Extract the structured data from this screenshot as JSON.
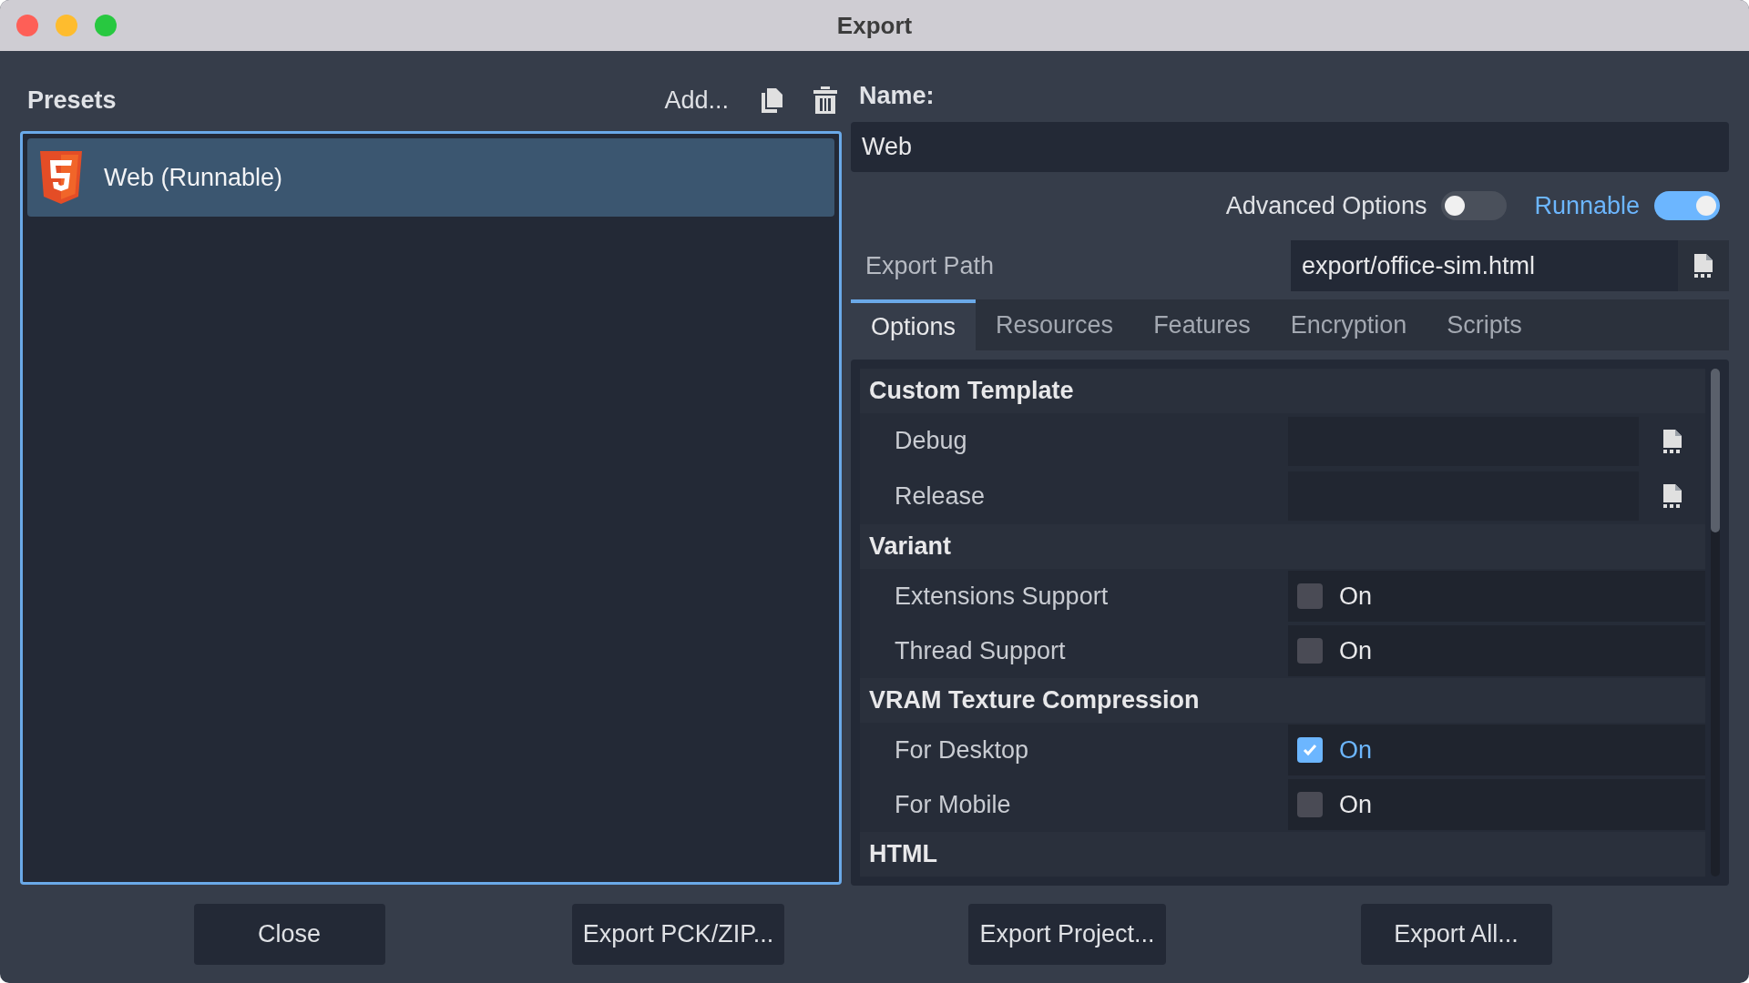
{
  "window": {
    "title": "Export"
  },
  "presets": {
    "title": "Presets",
    "add_label": "Add...",
    "items": [
      {
        "label": "Web (Runnable)",
        "selected": true
      }
    ]
  },
  "name": {
    "label": "Name:",
    "value": "Web"
  },
  "toggles": [
    {
      "label": "Advanced Options",
      "on": false
    },
    {
      "label": "Runnable",
      "on": true
    }
  ],
  "export_path": {
    "label": "Export Path",
    "value": "export/office-sim.html"
  },
  "tabs": [
    {
      "label": "Options",
      "selected": true
    },
    {
      "label": "Resources",
      "selected": false
    },
    {
      "label": "Features",
      "selected": false
    },
    {
      "label": "Encryption",
      "selected": false
    },
    {
      "label": "Scripts",
      "selected": false
    }
  ],
  "options": [
    {
      "kind": "section",
      "label": "Custom Template"
    },
    {
      "kind": "file",
      "label": "Debug"
    },
    {
      "kind": "file",
      "label": "Release"
    },
    {
      "kind": "section",
      "label": "Variant"
    },
    {
      "kind": "check",
      "label": "Extensions Support",
      "checked": false,
      "value": "On"
    },
    {
      "kind": "check",
      "label": "Thread Support",
      "checked": false,
      "value": "On"
    },
    {
      "kind": "section",
      "label": "VRAM Texture Compression"
    },
    {
      "kind": "check",
      "label": "For Desktop",
      "checked": true,
      "value": "On"
    },
    {
      "kind": "check",
      "label": "For Mobile",
      "checked": false,
      "value": "On"
    },
    {
      "kind": "section",
      "label": "HTML"
    }
  ],
  "buttons": [
    "Close",
    "Export PCK/ZIP...",
    "Export Project...",
    "Export All..."
  ]
}
